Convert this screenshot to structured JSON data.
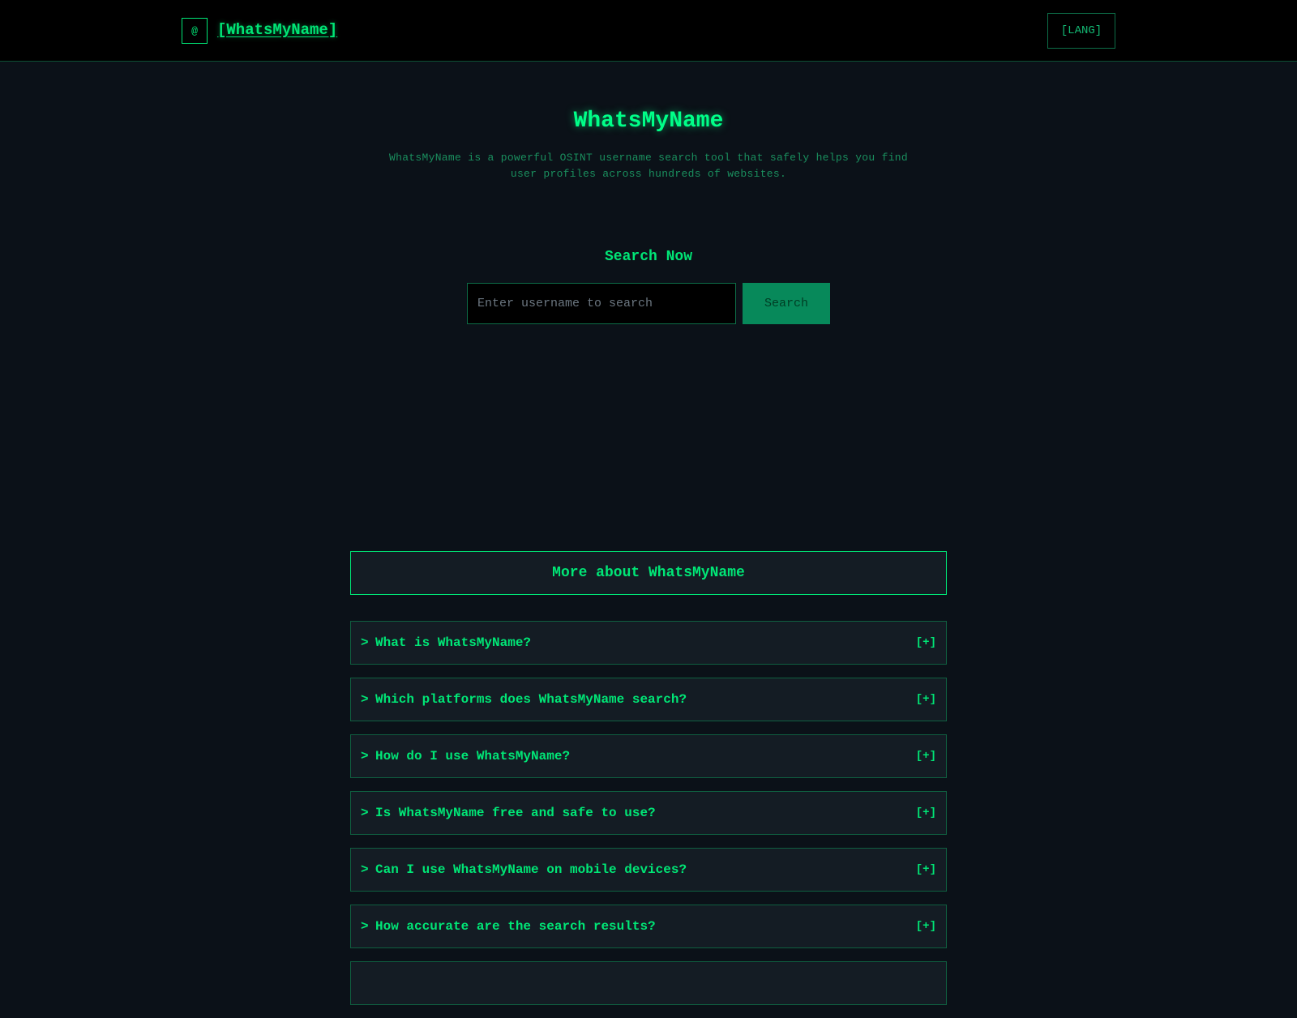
{
  "header": {
    "logo_glyph": "@",
    "brand": "[WhatsMyName]",
    "lang_button": "[LANG]"
  },
  "hero": {
    "title": "WhatsMyName",
    "description": "WhatsMyName is a powerful OSINT username search tool that safely helps you find user profiles across hundreds of websites."
  },
  "search": {
    "heading": "Search Now",
    "placeholder": "Enter username to search",
    "button": "Search"
  },
  "faq": {
    "heading": "More about WhatsMyName",
    "arrow": ">",
    "toggle": "[+]",
    "items": [
      {
        "question": "What is WhatsMyName?"
      },
      {
        "question": "Which platforms does WhatsMyName search?"
      },
      {
        "question": "How do I use WhatsMyName?"
      },
      {
        "question": "Is WhatsMyName free and safe to use?"
      },
      {
        "question": "Can I use WhatsMyName on mobile devices?"
      },
      {
        "question": "How accurate are the search results?"
      },
      {
        "question": ""
      }
    ]
  },
  "colors": {
    "accent": "#00e676",
    "background": "#0b1118",
    "header_bg": "#000000",
    "button_bg": "#07895a"
  }
}
